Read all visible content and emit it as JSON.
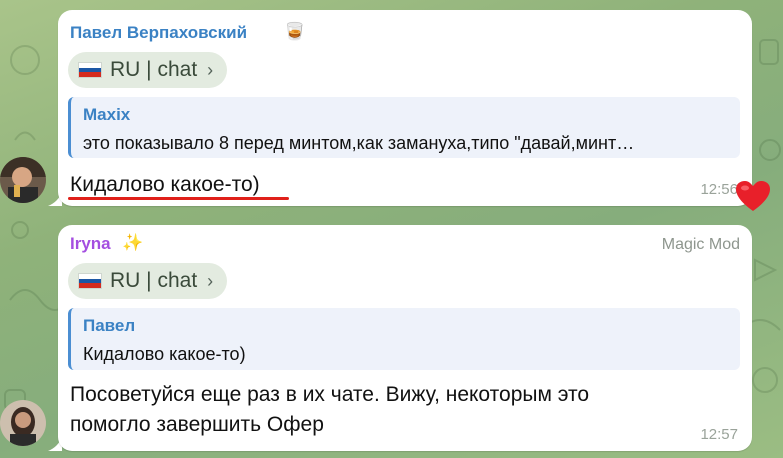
{
  "messages": [
    {
      "sender": "Павел Верпаховский",
      "sender_color": "#3b82c4",
      "sender_emoji": "🥃",
      "tag": "RU | chat",
      "reply_name": "Maxix",
      "reply_text": "это показывало 8 перед минтом,как замануха,типо \"давай,минт…",
      "text": "Кидалово какое-то)",
      "time": "12:56",
      "reaction": "heart"
    },
    {
      "sender": "Iryna",
      "sender_color": "#a44ee0",
      "sender_emoji": "✨",
      "role": "Magic Mod",
      "tag": "RU | chat",
      "reply_name": "Павел",
      "reply_text": "Кидалово какое-то)",
      "text_line1": "Посоветуйся еще раз в их чате. Вижу, некоторым это",
      "text_line2": "помогло завершить Офер",
      "time": "12:57"
    }
  ]
}
